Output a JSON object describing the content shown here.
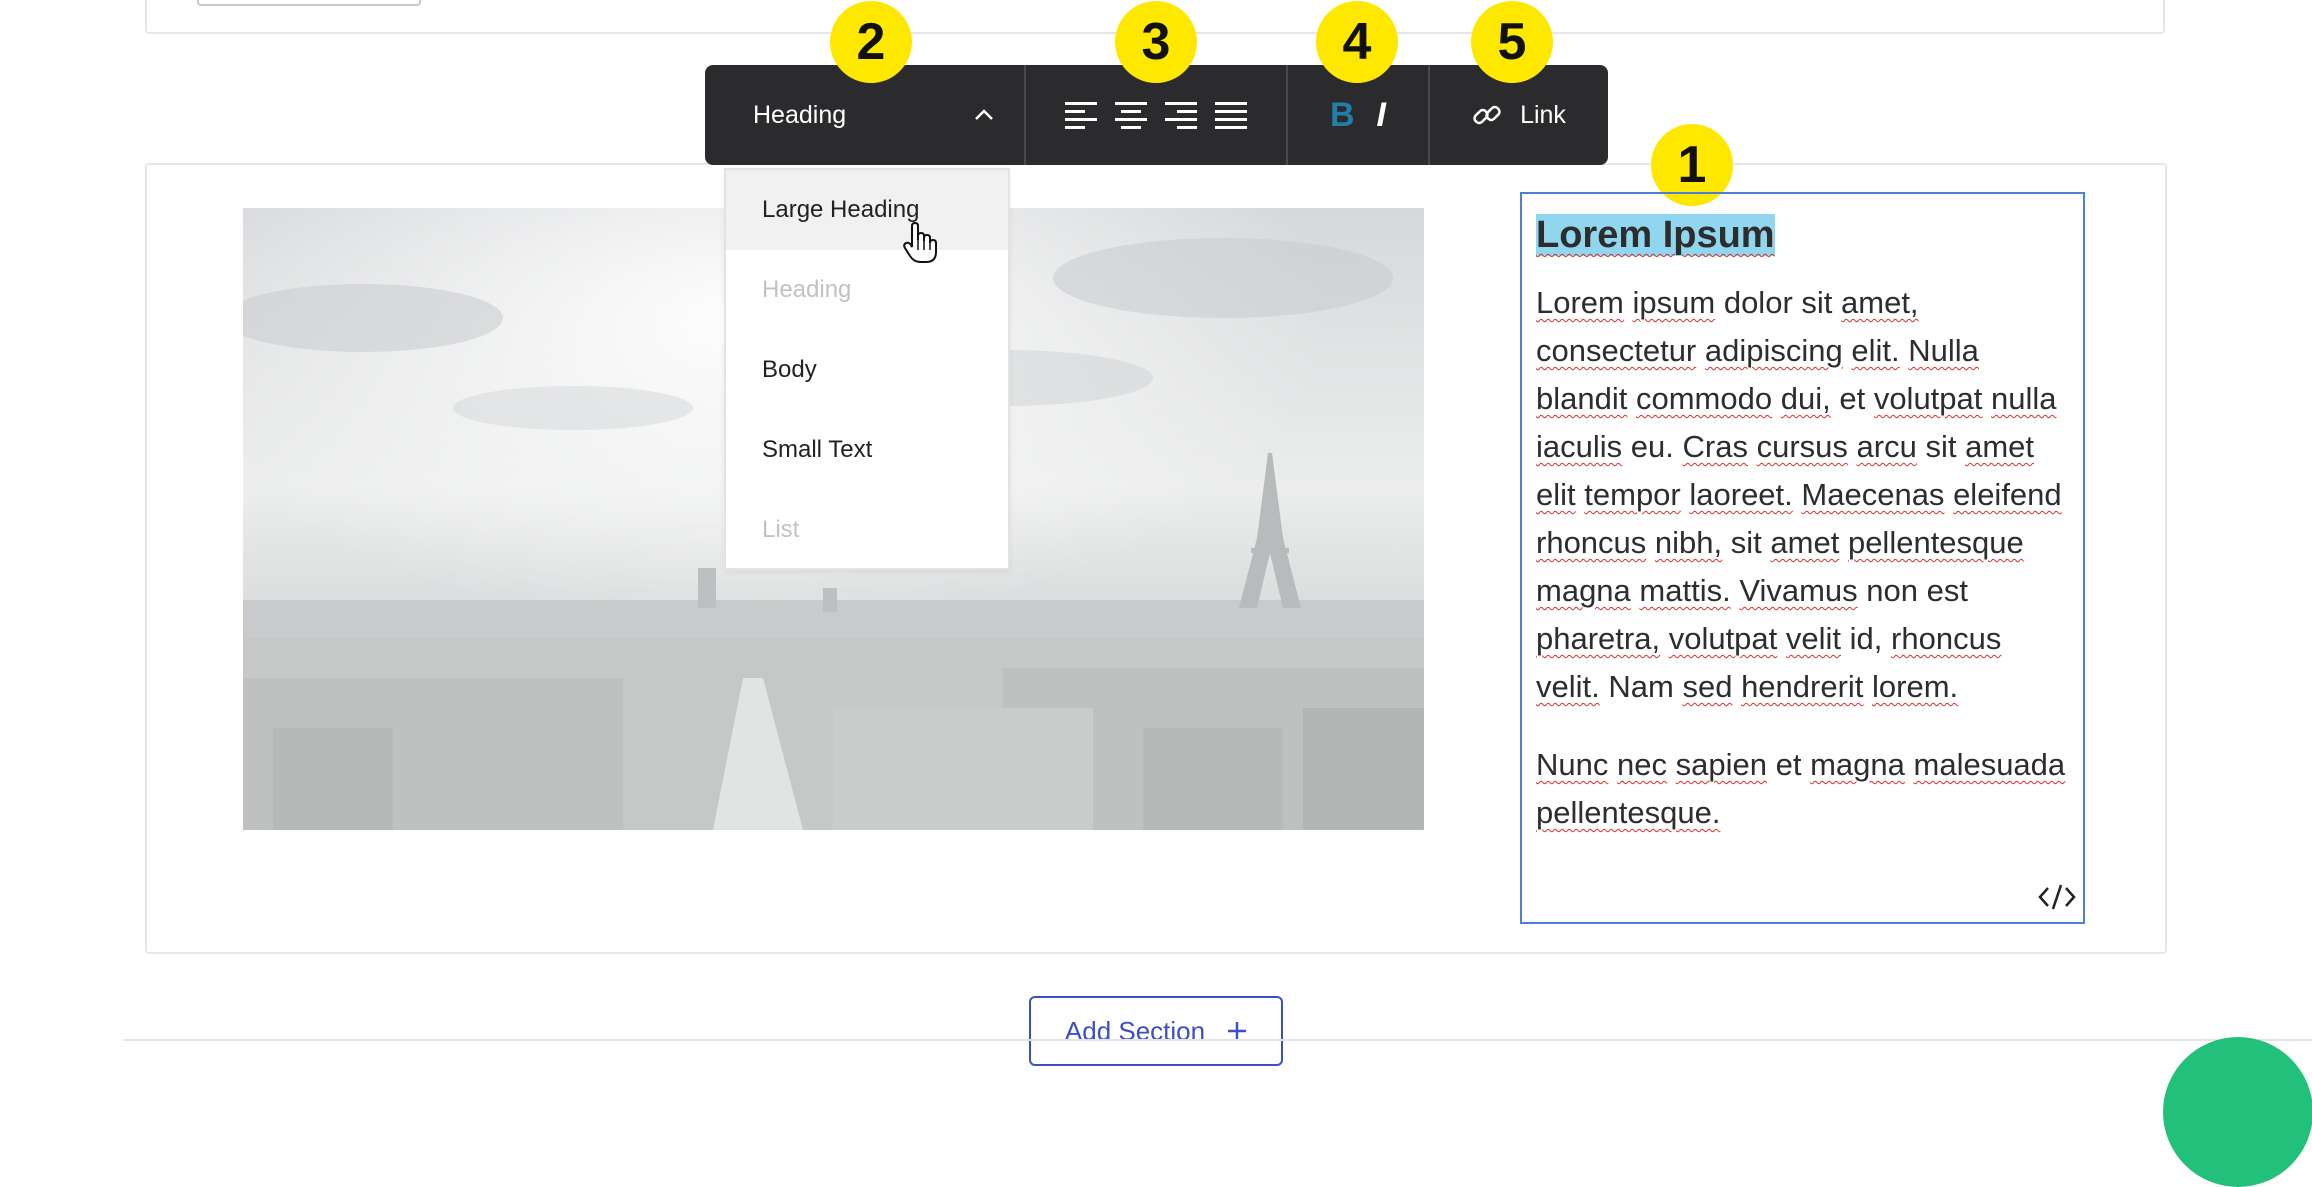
{
  "toolbar": {
    "text_style": "Heading",
    "link_label": "Link",
    "bold_glyph": "B",
    "italic_glyph": "I"
  },
  "dropdown": {
    "options": [
      {
        "label": "Large Heading",
        "state": "hover"
      },
      {
        "label": "Heading",
        "state": "disabled"
      },
      {
        "label": "Body",
        "state": "normal"
      },
      {
        "label": "Small Text",
        "state": "normal"
      },
      {
        "label": "List",
        "state": "disabled"
      }
    ]
  },
  "markers": [
    "1",
    "2",
    "3",
    "4",
    "5"
  ],
  "text_block": {
    "heading": "Lorem Ipsum",
    "paragraph1": "Lorem ipsum dolor sit amet, consectetur adipiscing elit. Nulla blandit commodo dui, et volutpat nulla iaculis eu. Cras cursus arcu sit amet elit tempor laoreet. Maecenas eleifend rhoncus nibh, sit amet pellentesque magna mattis. Vivamus non est pharetra, volutpat velit id, rhoncus velit. Nam sed hendrerit lorem.",
    "paragraph2": "Nunc nec sapien et magna malesuada pellentesque."
  },
  "add_section": {
    "label": "Add Section",
    "icon": "plus-icon"
  },
  "colors": {
    "toolbar_bg": "#2b2b2d",
    "marker": "#ffe800",
    "selection_highlight": "#8fd6ee",
    "accent": "#3b4fc7",
    "bold_active": "#1f7fa6",
    "text_frame": "#4f7fd3",
    "help_bubble": "#22c07a"
  }
}
